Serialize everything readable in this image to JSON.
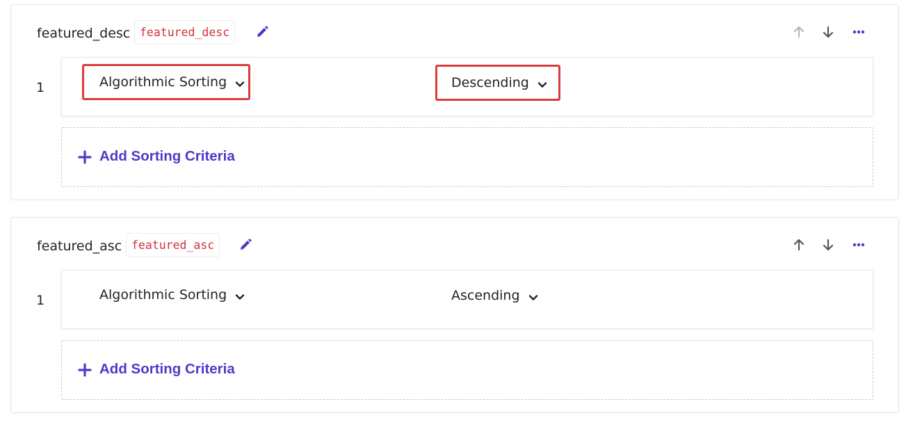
{
  "colors": {
    "accent": "#4b3bc9",
    "code_text": "#d1323b",
    "highlight_outline": "#dd3b3b",
    "icon_gray": "#555555",
    "icon_disabled": "#b5b5b5"
  },
  "cards": [
    {
      "name": "featured_desc",
      "code": "featured_desc",
      "row_index": "1",
      "sort_field": "Algorithmic Sorting",
      "sort_order": "Descending",
      "add_label": "Add Sorting Criteria",
      "icons": {
        "edit": "pencil-icon",
        "up": "arrow-up-icon",
        "down": "arrow-down-icon",
        "more": "more-horizontal-icon"
      },
      "up_disabled": true
    },
    {
      "name": "featured_asc",
      "code": "featured_asc",
      "row_index": "1",
      "sort_field": "Algorithmic Sorting",
      "sort_order": "Ascending",
      "add_label": "Add Sorting Criteria",
      "icons": {
        "edit": "pencil-icon",
        "up": "arrow-up-icon",
        "down": "arrow-down-icon",
        "more": "more-horizontal-icon"
      },
      "up_disabled": false
    }
  ]
}
